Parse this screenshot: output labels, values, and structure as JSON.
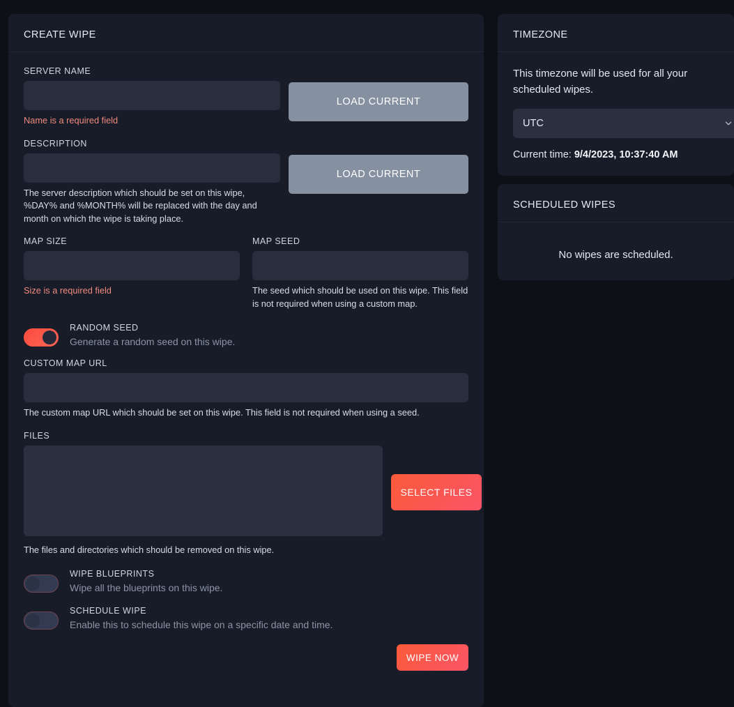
{
  "theme": {
    "page_background": "#0d1017",
    "card_background": "#181c28",
    "input_background": "#292d3e",
    "accent_gradient_start": "#fb5a39",
    "accent_gradient_end": "#fb5467",
    "error_color": "#f08a7e",
    "secondary_button": "#8590a1"
  },
  "create_wipe": {
    "title": "CREATE WIPE",
    "server_name": {
      "label": "SERVER NAME",
      "value": "",
      "placeholder": "",
      "error": "Name is a required field",
      "button_label": "LOAD CURRENT"
    },
    "description": {
      "label": "DESCRIPTION",
      "value": "",
      "placeholder": "",
      "help": "The server description which should be set on this wipe, %DAY% and %MONTH% will be replaced with the day and month on which the wipe is taking place.",
      "button_label": "LOAD CURRENT"
    },
    "map_size": {
      "label": "MAP SIZE",
      "value": "",
      "placeholder": "",
      "error": "Size is a required field"
    },
    "map_seed": {
      "label": "MAP SEED",
      "value": "",
      "placeholder": "",
      "help": "The seed which should be used on this wipe. This field is not required when using a custom map."
    },
    "random_seed": {
      "title": "RANDOM SEED",
      "description": "Generate a random seed on this wipe.",
      "state": "on"
    },
    "custom_map_url": {
      "label": "CUSTOM MAP URL",
      "value": "",
      "placeholder": "",
      "help": "The custom map URL which should be set on this wipe. This field is not required when using a seed."
    },
    "files": {
      "label": "FILES",
      "value": "",
      "placeholder": "",
      "help": "The files and directories which should be removed on this wipe.",
      "button_label": "SELECT FILES"
    },
    "wipe_blueprints": {
      "title": "WIPE BLUEPRINTS",
      "description": "Wipe all the blueprints on this wipe.",
      "state": "off"
    },
    "schedule_wipe": {
      "title": "SCHEDULE WIPE",
      "description": "Enable this to schedule this wipe on a specific date and time.",
      "state": "off"
    },
    "submit_label": "WIPE NOW"
  },
  "timezone": {
    "title": "TIMEZONE",
    "description": "This timezone will be used for all your scheduled wipes.",
    "selected": "UTC",
    "current_time_label": "Current time:",
    "current_time_value": "9/4/2023, 10:37:40 AM"
  },
  "scheduled_wipes": {
    "title": "SCHEDULED WIPES",
    "empty_message": "No wipes are scheduled."
  }
}
